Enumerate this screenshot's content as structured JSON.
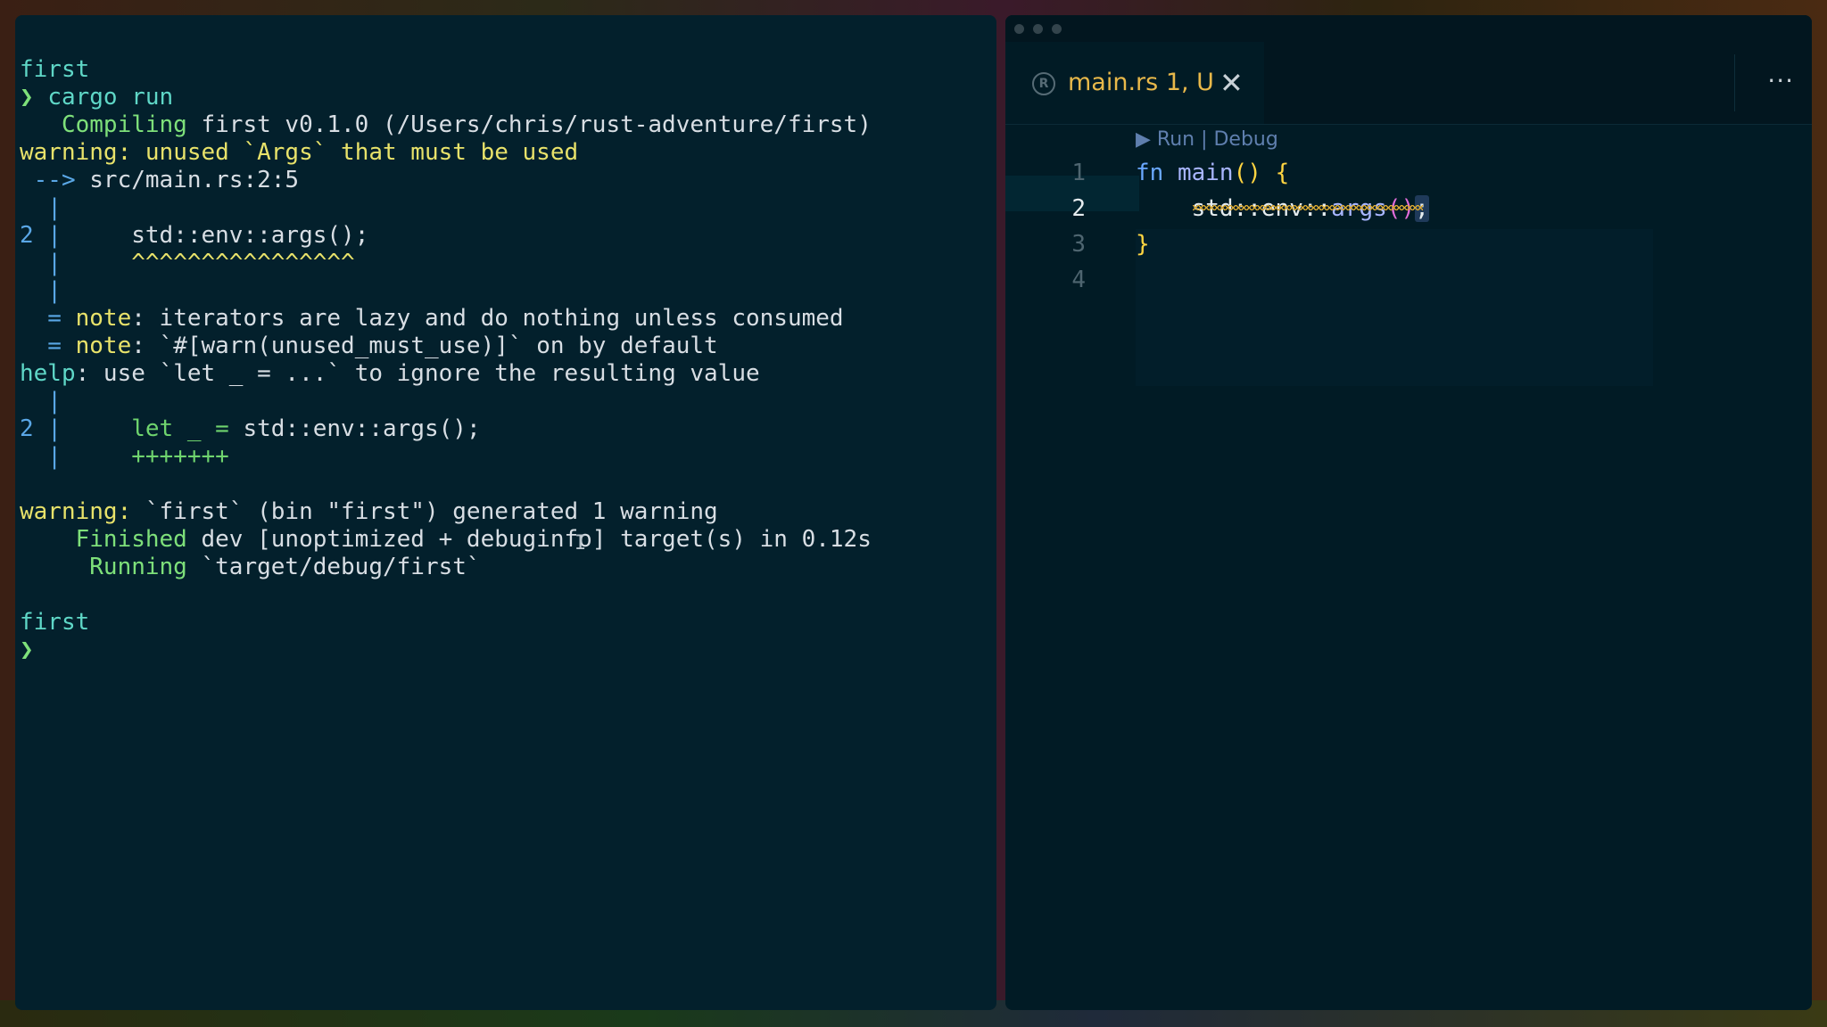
{
  "terminal": {
    "lines": [
      {
        "segs": [
          {
            "t": "first",
            "c": "c-teal"
          }
        ]
      },
      {
        "segs": [
          {
            "t": "❯ ",
            "c": "c-bright-green"
          },
          {
            "t": "cargo run",
            "c": "c-teal"
          }
        ]
      },
      {
        "segs": [
          {
            "t": "   Compiling ",
            "c": "c-bright-green"
          },
          {
            "t": "first v0.1.0 (/Users/chris/rust-adventure/first)",
            "c": ""
          }
        ]
      },
      {
        "segs": [
          {
            "t": "warning: ",
            "c": "c-yellow"
          },
          {
            "t": "unused `Args` that must be used",
            "c": "c-yellow"
          }
        ]
      },
      {
        "segs": [
          {
            "t": " --> ",
            "c": "c-gutter"
          },
          {
            "t": "src/main.rs:2:5",
            "c": ""
          }
        ]
      },
      {
        "segs": [
          {
            "t": "  |",
            "c": "c-gutter"
          }
        ]
      },
      {
        "segs": [
          {
            "t": "2 |",
            "c": "c-gutter"
          },
          {
            "t": "     std::env::args();",
            "c": ""
          }
        ]
      },
      {
        "segs": [
          {
            "t": "  |",
            "c": "c-gutter"
          },
          {
            "t": "     ^^^^^^^^^^^^^^^^",
            "c": "c-yellow"
          }
        ]
      },
      {
        "segs": [
          {
            "t": "  |",
            "c": "c-gutter"
          }
        ]
      },
      {
        "segs": [
          {
            "t": "  = ",
            "c": "c-gutter"
          },
          {
            "t": "note",
            "c": "c-yellow"
          },
          {
            "t": ": iterators are lazy and do nothing unless consumed",
            "c": ""
          }
        ]
      },
      {
        "segs": [
          {
            "t": "  = ",
            "c": "c-gutter"
          },
          {
            "t": "note",
            "c": "c-yellow"
          },
          {
            "t": ": `#[warn(unused_must_use)]` on by default",
            "c": ""
          }
        ]
      },
      {
        "segs": [
          {
            "t": "help",
            "c": "c-teal"
          },
          {
            "t": ": use `let _ = ...` to ignore the resulting value",
            "c": ""
          }
        ]
      },
      {
        "segs": [
          {
            "t": "  |",
            "c": "c-gutter"
          }
        ]
      },
      {
        "segs": [
          {
            "t": "2 |",
            "c": "c-gutter"
          },
          {
            "t": "     ",
            "c": ""
          },
          {
            "t": "let _ = ",
            "c": "c-green"
          },
          {
            "t": "std::env::args();",
            "c": ""
          }
        ]
      },
      {
        "segs": [
          {
            "t": "  |",
            "c": "c-gutter"
          },
          {
            "t": "     +++++++",
            "c": "c-plus"
          }
        ]
      },
      {
        "segs": []
      },
      {
        "segs": [
          {
            "t": "warning: ",
            "c": "c-yellow"
          },
          {
            "t": "`first` (bin \"first\") generated 1 warning",
            "c": ""
          }
        ]
      },
      {
        "segs": [
          {
            "t": "    Finished ",
            "c": "c-bright-green"
          },
          {
            "t": "dev [unoptimized + debuginfo] target(s) in 0.12s",
            "c": ""
          }
        ]
      },
      {
        "segs": [
          {
            "t": "     Running ",
            "c": "c-bright-green"
          },
          {
            "t": "`target/debug/first`",
            "c": ""
          }
        ]
      },
      {
        "segs": []
      },
      {
        "segs": [
          {
            "t": "first",
            "c": "c-teal"
          }
        ]
      },
      {
        "segs": [
          {
            "t": "❯",
            "c": "c-bright-green"
          }
        ]
      }
    ]
  },
  "editor": {
    "tab": {
      "icon": "rust-icon",
      "filename": "main.rs",
      "status": "1, U",
      "close_label": "✕"
    },
    "more_label": "···",
    "codelens": "▶ Run | Debug",
    "gutter": [
      "1",
      "2",
      "3",
      "4"
    ],
    "code": {
      "line1": {
        "kw": "fn",
        "fn": "main",
        "parens": "()",
        "brace": "{"
      },
      "line2": {
        "ns": "std::env::",
        "method": "args",
        "parens": "()",
        "semi": ";"
      },
      "line3": {
        "brace": "}"
      }
    }
  }
}
